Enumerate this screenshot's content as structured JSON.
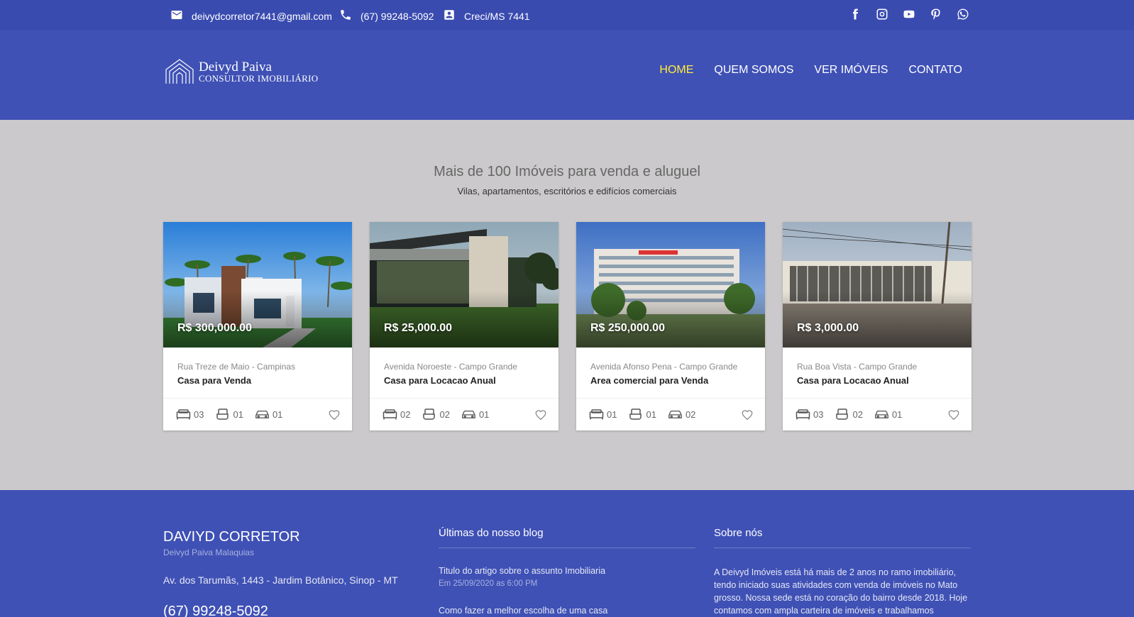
{
  "topbar": {
    "email": "deivydcorretor7441@gmail.com",
    "phone": "(67) 99248-5092",
    "creci": "Creci/MS 7441",
    "social": [
      "facebook-icon",
      "instagram-icon",
      "youtube-icon",
      "pinterest-icon",
      "whatsapp-icon"
    ]
  },
  "brand": {
    "name": "Deivyd Paiva",
    "subtitle": "CONSULTOR IMOBILIÁRIO"
  },
  "nav": [
    {
      "label": "HOME",
      "active": true
    },
    {
      "label": "QUEM SOMOS",
      "active": false
    },
    {
      "label": "VER IMÓVEIS",
      "active": false
    },
    {
      "label": "CONTATO",
      "active": false
    }
  ],
  "section": {
    "title": "Mais de 100 Imóveis para venda e aluguel",
    "subtitle": "Vilas, apartamentos, escritórios e edifícios comerciais"
  },
  "listings": [
    {
      "price": "R$ 300,000.00",
      "address": "Rua Treze de Maio - Campinas",
      "name": "Casa para Venda",
      "beds": "03",
      "baths": "01",
      "garage": "01"
    },
    {
      "price": "R$ 25,000.00",
      "address": "Avenida Noroeste - Campo Grande",
      "name": "Casa para Locacao Anual",
      "beds": "02",
      "baths": "02",
      "garage": "01"
    },
    {
      "price": "R$ 250,000.00",
      "address": "Avenida Afonso Pena - Campo Grande",
      "name": "Area comercial para Venda",
      "beds": "01",
      "baths": "01",
      "garage": "02"
    },
    {
      "price": "R$ 3,000.00",
      "address": "Rua Boa Vista - Campo Grande",
      "name": "Casa para Locacao Anual",
      "beds": "03",
      "baths": "02",
      "garage": "01"
    }
  ],
  "footer": {
    "brand_title": "DAVIYD CORRETOR",
    "brand_sub": "Deivyd Paiva Malaquias",
    "address": "Av. dos Tarumãs, 1443 - Jardim Botânico, Sinop - MT",
    "phone": "(67) 99248-5092",
    "blog_heading": "Últimas do nosso blog",
    "posts": [
      {
        "title": "Titulo do artigo sobre o assunto Imobiliaria",
        "date": "Em 25/09/2020 as 6:00 PM"
      },
      {
        "title": "Como fazer a melhor escolha de uma casa",
        "date": ""
      }
    ],
    "about_heading": "Sobre nós",
    "about_text": "A Deivyd Imóveis está há mais de 2 anos no ramo imobiliário, tendo iniciado suas atividades com venda de imóveis no Mato grosso. Nossa sede está no coração do bairro desde 2018. Hoje contamos com ampla carteira de imóveis e trabalhamos"
  },
  "colors": {
    "topbar": "#3a4bb0",
    "header": "#3f51b5",
    "active_nav": "#ffeb3b",
    "page_bg": "#cbc9cb"
  }
}
